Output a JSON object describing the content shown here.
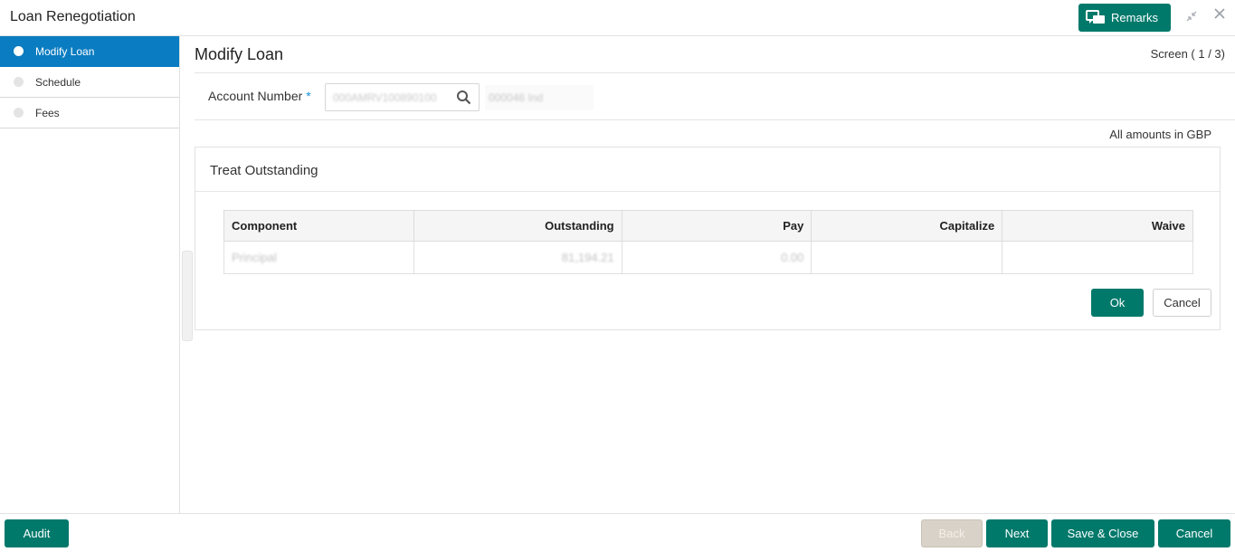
{
  "app": {
    "title": "Loan Renegotiation"
  },
  "header": {
    "remarks_label": "Remarks"
  },
  "sidebar": {
    "items": [
      {
        "label": "Modify Loan",
        "active": true
      },
      {
        "label": "Schedule",
        "active": false
      },
      {
        "label": "Fees",
        "active": false
      }
    ]
  },
  "main": {
    "title": "Modify Loan",
    "screen_indicator": "Screen ( 1 / 3)",
    "account_label": "Account Number",
    "required_mark": "*",
    "account_number": "000AMRV100890100",
    "account_name": "000046 Ind",
    "amounts_note": "All amounts in GBP"
  },
  "treat_outstanding": {
    "title": "Treat Outstanding",
    "columns": [
      "Component",
      "Outstanding",
      "Pay",
      "Capitalize",
      "Waive"
    ],
    "rows": [
      {
        "component": "Principal",
        "outstanding": "81,194.21",
        "pay": "0.00",
        "capitalize": "",
        "waive": ""
      }
    ],
    "ok_label": "Ok",
    "cancel_label": "Cancel"
  },
  "footer": {
    "audit_label": "Audit",
    "back_label": "Back",
    "next_label": "Next",
    "save_close_label": "Save & Close",
    "cancel_label": "Cancel"
  },
  "colors": {
    "primary": "#00796b",
    "active_nav": "#0a7cc1",
    "disabled": "#d9d2c8"
  },
  "icons": {
    "remarks": "chat-bubbles-icon",
    "minimize": "minimize-icon",
    "close": "close-icon",
    "search": "search-icon"
  }
}
